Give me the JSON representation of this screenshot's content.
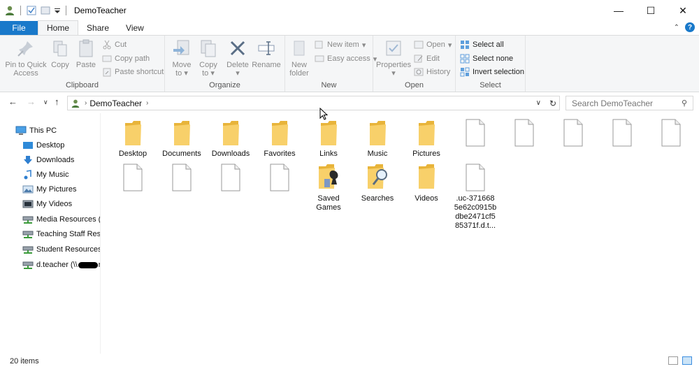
{
  "window": {
    "title": "DemoTeacher",
    "controls": [
      "—",
      "☐",
      "✕"
    ]
  },
  "ribbon_tabs": [
    {
      "label": "File"
    },
    {
      "label": "Home"
    },
    {
      "label": "Share"
    },
    {
      "label": "View"
    }
  ],
  "ribbon": {
    "clipboard": {
      "label": "Clipboard",
      "pin": "Pin to Quick",
      "pin2": "Access",
      "copy": "Copy",
      "paste": "Paste",
      "cut": "Cut",
      "copy_path": "Copy path",
      "paste_shortcut": "Paste shortcut"
    },
    "organize": {
      "label": "Organize",
      "move_to": "Move",
      "move_to2": "to",
      "copy_to": "Copy",
      "copy_to2": "to",
      "delete": "Delete",
      "rename": "Rename"
    },
    "new": {
      "label": "New",
      "new_folder": "New",
      "new_folder2": "folder",
      "new_item": "New item",
      "easy_access": "Easy access"
    },
    "open": {
      "label": "Open",
      "properties": "Properties",
      "open": "Open",
      "edit": "Edit",
      "history": "History"
    },
    "select": {
      "label": "Select",
      "select_all": "Select all",
      "select_none": "Select none",
      "invert": "Invert selection"
    }
  },
  "address": {
    "crumb": "DemoTeacher",
    "search_placeholder": "Search DemoTeacher"
  },
  "nav_pane": [
    {
      "label": "This PC",
      "icon": "pc-icon"
    },
    {
      "label": "Desktop",
      "icon": "desktop-icon"
    },
    {
      "label": "Downloads",
      "icon": "downloads-icon"
    },
    {
      "label": "My Music",
      "icon": "music-icon"
    },
    {
      "label": "My Pictures",
      "icon": "pictures-icon"
    },
    {
      "label": "My Videos",
      "icon": "videos-icon"
    },
    {
      "label": "Media Resources (J:",
      "icon": "network-drive-icon"
    },
    {
      "label": "Teaching Staff Reso",
      "icon": "network-drive-icon"
    },
    {
      "label": "Student Resources (",
      "icon": "network-drive-icon"
    },
    {
      "label": "d.teacher (\\\\",
      "suffix": "r",
      "icon": "network-drive-icon"
    }
  ],
  "items": [
    {
      "label": "Desktop",
      "type": "folder"
    },
    {
      "label": "Documents",
      "type": "folder"
    },
    {
      "label": "Downloads",
      "type": "folder"
    },
    {
      "label": "Favorites",
      "type": "folder"
    },
    {
      "label": "Links",
      "type": "folder"
    },
    {
      "label": "Music",
      "type": "folder"
    },
    {
      "label": "Pictures",
      "type": "folder"
    },
    {
      "label": "",
      "type": "file"
    },
    {
      "label": "",
      "type": "file"
    },
    {
      "label": "",
      "type": "file"
    },
    {
      "label": "",
      "type": "file"
    },
    {
      "label": "",
      "type": "file"
    },
    {
      "label": "",
      "type": "file"
    },
    {
      "label": "",
      "type": "file"
    },
    {
      "label": "",
      "type": "file"
    },
    {
      "label": "",
      "type": "file"
    },
    {
      "label": "Saved Games",
      "line1": "Saved",
      "line2": "Games",
      "type": "folder-games"
    },
    {
      "label": "Searches",
      "type": "folder-search"
    },
    {
      "label": "Videos",
      "type": "folder"
    },
    {
      "label": ".uc-3716685e62c0915bdbe2471cf585371f.d.t...",
      "line1": ".uc-371668",
      "line2": "5e62c0915b",
      "line3": "dbe2471cf5",
      "line4": "85371f.d.t...",
      "type": "file"
    }
  ],
  "status": {
    "count": "20 items"
  },
  "colors": {
    "file_tab": "#1979ca",
    "ribbon_bg": "#f5f6f7",
    "folder": "#f5c64f"
  }
}
